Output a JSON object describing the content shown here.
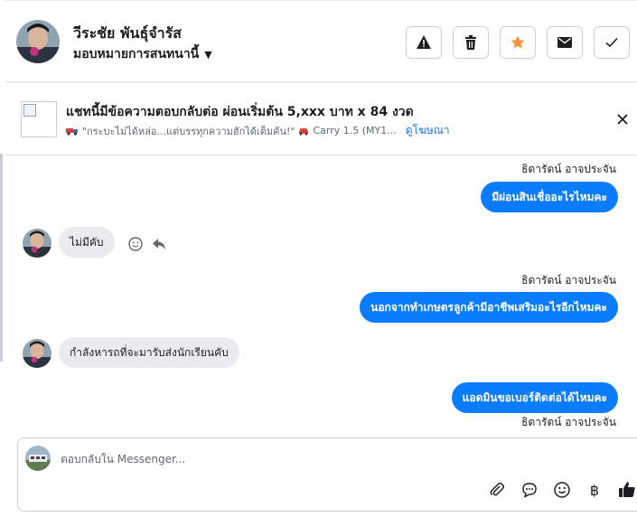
{
  "header": {
    "name": "วีระชัย พันธุ์จำรัส",
    "assign_label": "มอบหมายการสนทนานี้",
    "actions": [
      "report-icon",
      "trash-icon",
      "star-icon",
      "mail-icon",
      "check-icon"
    ],
    "star_color": "#f7923b"
  },
  "banner": {
    "title": "แชทนี้มีข้อความตอบกลับต่อ ผ่อนเริ่มต้น 5,xxx บาท x 84 งวด",
    "subtitle": "\"กระบะไม่ได้หล่อ...แต่บรรทุกความฮักได้เต็มคัน!\"",
    "car": "Carry 1.5 (MY1...",
    "link": "ดูโฆษณา"
  },
  "messages": [
    {
      "direction": "out",
      "sender": "ธิดารัตน์ อาจประจัน",
      "text": "มีผ่อนสินเชื่ออะไรไหมคะ"
    },
    {
      "direction": "in",
      "text": "ไม่มีคับ"
    },
    {
      "direction": "out",
      "sender": "ธิดารัตน์ อาจประจัน",
      "text": "นอกจากทำเกษตรลูกค้ามีอาชีพเสริมอะไรอีกไหมคะ"
    },
    {
      "direction": "in",
      "text": "กำลังหารถที่จะมารับส่งนักเรียนคับ"
    },
    {
      "direction": "out",
      "sender": "ธิดารัตน์ อาจประจัน",
      "text": "แอดมินขอเบอร์ติดต่อได้ไหมคะ"
    }
  ],
  "composer": {
    "placeholder": "ตอบกลับใน Messenger...",
    "tools": [
      "attach-icon",
      "comment-icon",
      "emoji-icon",
      "baht-icon",
      "like-icon"
    ],
    "baht_symbol": "฿"
  },
  "colors": {
    "outgoing_bubble": "#0a7cff",
    "incoming_bubble": "#e9ebee",
    "link": "#216fdb"
  }
}
